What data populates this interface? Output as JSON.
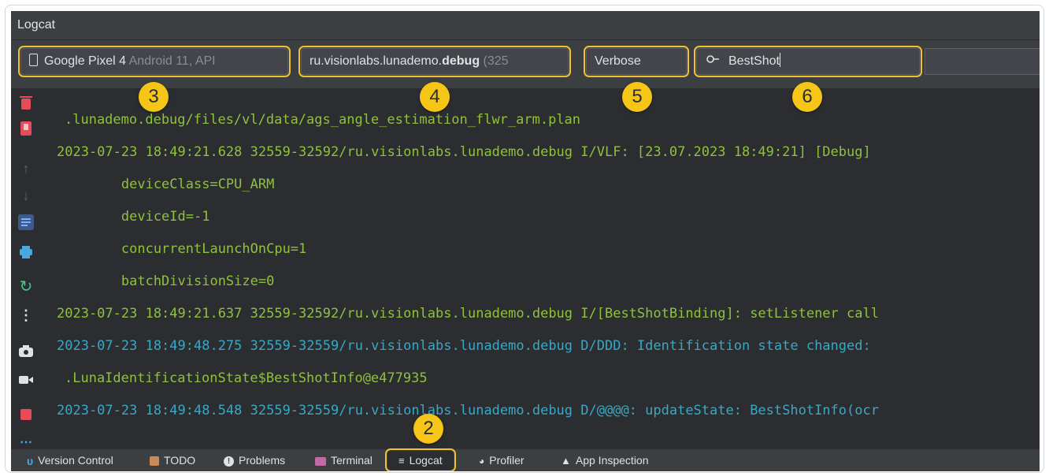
{
  "window": {
    "title": "Logcat"
  },
  "filters": {
    "device_name": "Google Pixel 4",
    "device_detail": "Android 11, API",
    "process_prefix": "ru.visionlabs.lunademo.",
    "process_bold": "debug",
    "process_pid": "(325",
    "level": "Verbose",
    "search_value": "BestShot"
  },
  "badges": {
    "b2": "2",
    "b3": "3",
    "b4": "4",
    "b5": "5",
    "b6": "6"
  },
  "log_lines": [
    {
      "text": ".lunademo.debug/files/vl/data/ags_angle_estimation_flwr_arm.plan",
      "color": "green"
    },
    {
      "text": "2023-07-23 18:49:21.628 32559-32592/ru.visionlabs.lunademo.debug I/VLF: [23.07.2023 18:49:21] [Debug]",
      "color": "green"
    },
    {
      "text": "        deviceClass=CPU_ARM",
      "color": "green"
    },
    {
      "text": "        deviceId=-1",
      "color": "green"
    },
    {
      "text": "        concurrentLaunchOnCpu=1",
      "color": "green"
    },
    {
      "text": "        batchDivisionSize=0",
      "color": "green"
    },
    {
      "text": "2023-07-23 18:49:21.637 32559-32592/ru.visionlabs.lunademo.debug I/[BestShotBinding]: setListener call",
      "color": "green"
    },
    {
      "text": "2023-07-23 18:49:48.275 32559-32559/ru.visionlabs.lunademo.debug D/DDD: Identification state changed:",
      "color": "cyan"
    },
    {
      "text": ".LunaIdentificationState$BestShotInfo@e477935",
      "color": "green"
    },
    {
      "text": "2023-07-23 18:49:48.548 32559-32559/ru.visionlabs.lunademo.debug D/@@@@: updateState: BestShotInfo(ocr",
      "color": "cyan"
    }
  ],
  "statusbar": {
    "version_control": "Version Control",
    "todo": "TODO",
    "problems": "Problems",
    "terminal": "Terminal",
    "logcat": "Logcat",
    "profiler": "Profiler",
    "app_inspection": "App Inspection"
  },
  "colors": {
    "highlight": "#f2c12e",
    "log_green": "#8fc23c",
    "log_cyan": "#37a9c4",
    "background": "#2b2d31"
  },
  "icons": {
    "sidebar": [
      "trash-icon",
      "scroll-to-end-icon",
      "up-arrow-icon",
      "down-arrow-icon",
      "soft-wrap-icon",
      "print-icon",
      "restart-icon",
      "more-icon",
      "camera-icon",
      "video-icon",
      "stop-icon",
      "ellipsis-icon"
    ]
  }
}
